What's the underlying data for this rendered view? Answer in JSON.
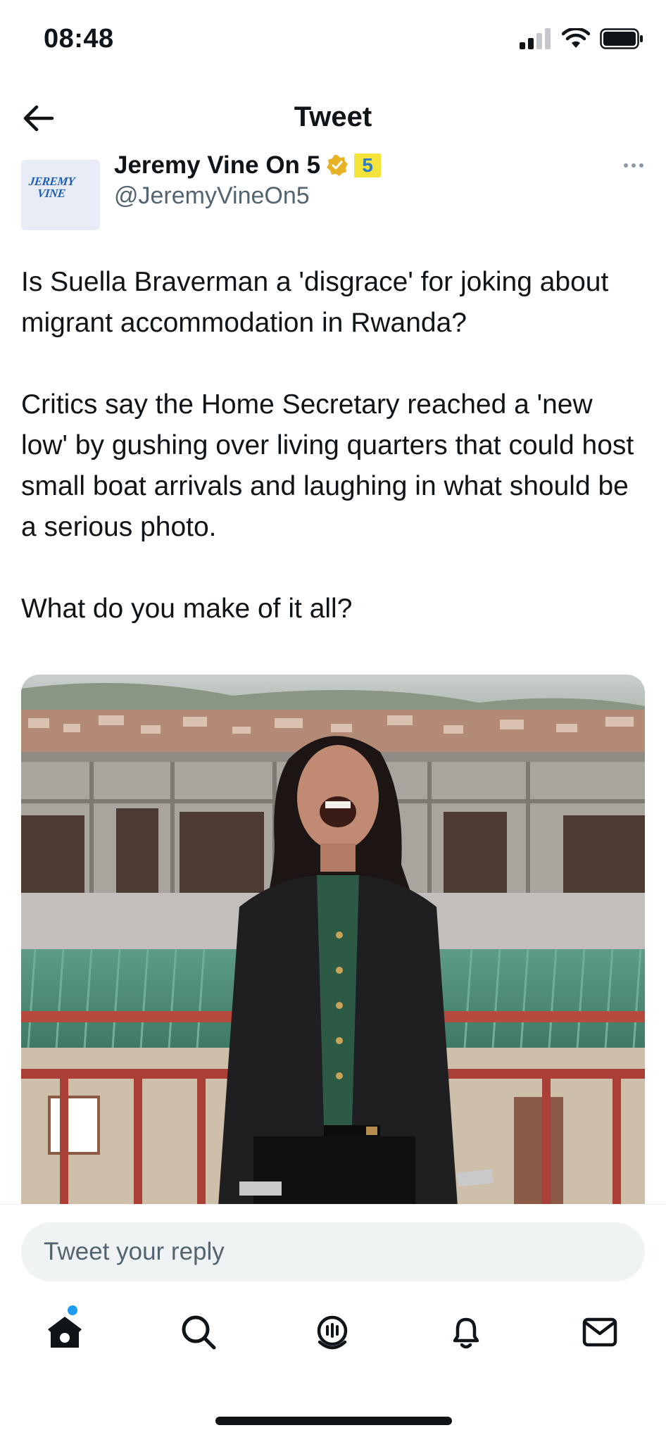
{
  "status_bar": {
    "time": "08:48"
  },
  "header": {
    "title": "Tweet"
  },
  "author": {
    "avatar_line1": "JEREMY",
    "avatar_line2": "VINE",
    "name": "Jeremy Vine On 5",
    "badge": "5",
    "handle": "@JeremyVineOn5"
  },
  "tweet": {
    "paragraphs": [
      "Is Suella Braverman a 'disgrace' for joking about migrant accommodation in Rwanda?",
      "Critics say the Home Secretary reached a 'new low' by gushing over living quarters that could host small boat arrivals and laughing in what should be a serious photo.",
      "What do you make of it all?"
    ]
  },
  "reply": {
    "placeholder": "Tweet your reply"
  },
  "tabs": [
    {
      "icon": "home-icon",
      "active": true,
      "has_notification_dot": true
    },
    {
      "icon": "search-icon"
    },
    {
      "icon": "spaces-icon"
    },
    {
      "icon": "notifications-icon"
    },
    {
      "icon": "messages-icon"
    }
  ],
  "colors": {
    "accent": "#1d9bf0",
    "text": "#0f1419",
    "secondary_text": "#536471",
    "verified_gold": "#e8b225",
    "badge_yellow": "#f4e33a"
  }
}
